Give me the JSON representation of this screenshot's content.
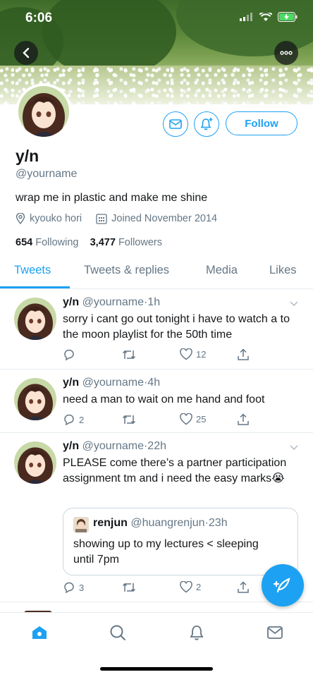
{
  "status_bar": {
    "time": "6:06"
  },
  "profile": {
    "name": "y/n",
    "handle": "@yourname",
    "bio": "wrap me in plastic and make me shine",
    "location": "kyouko hori",
    "joined": "Joined November 2014",
    "following_count": "654",
    "following_label": "Following",
    "followers_count": "3,477",
    "followers_label": "Followers",
    "follow_button": "Follow"
  },
  "tabs": [
    {
      "label": "Tweets",
      "active": true
    },
    {
      "label": "Tweets & replies"
    },
    {
      "label": "Media"
    },
    {
      "label": "Likes"
    }
  ],
  "tweets": [
    {
      "name": "y/n",
      "handle": "@yourname",
      "sep": "·",
      "time": "1h",
      "text": "sorry i cant go out tonight i have to watch a to the moon playlist for the 50th time",
      "replies": "",
      "retweets": "",
      "likes": "12"
    },
    {
      "name": "y/n",
      "handle": "@yourname",
      "sep": "·",
      "time": "4h",
      "text": "need a man to wait on me hand and foot",
      "replies": "2",
      "retweets": "",
      "likes": "25"
    },
    {
      "name": "y/n",
      "handle": "@yourname",
      "sep": "·",
      "time": "22h",
      "text": "PLEASE come there’s a partner participation assignment tm and i need the easy marks😭",
      "replies": "3",
      "retweets": "",
      "likes": "2",
      "quote": {
        "name": "renjun",
        "handle": "@huangrenjun",
        "sep": "·",
        "time": "23h",
        "text": "showing up to my lectures < sleeping until 7pm"
      }
    }
  ],
  "colors": {
    "accent": "#1da1f2",
    "secondary_text": "#657786",
    "border": "#e6ecf0"
  },
  "icons": [
    "back-arrow-icon",
    "more-icon",
    "mail-icon",
    "notification-add-icon",
    "location-icon",
    "calendar-icon",
    "reply-icon",
    "retweet-icon",
    "like-icon",
    "share-icon",
    "compose-icon",
    "home-icon",
    "search-icon",
    "notifications-icon",
    "messages-icon"
  ]
}
